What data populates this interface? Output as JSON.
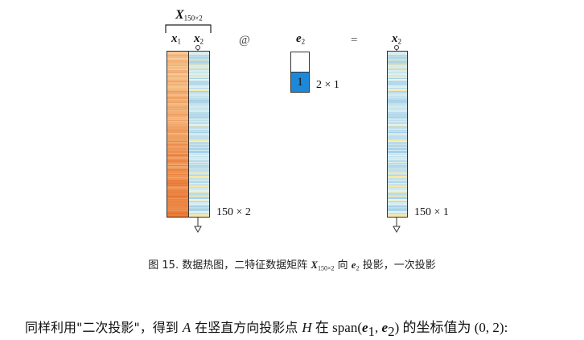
{
  "figure": {
    "matrix_label": "X",
    "matrix_label_sub": "150×2",
    "col1_label": "x",
    "col1_sub": "1",
    "col2_label": "x",
    "col2_sub": "2",
    "operator_at": "@",
    "vector_label": "e",
    "vector_sub": "2",
    "vector_values": [
      "",
      "1"
    ],
    "vector_dims": "2 × 1",
    "operator_eq": "=",
    "result_label": "x",
    "result_sub": "2",
    "matrix_dims": "150 × 2",
    "result_dims": "150 × 1",
    "colors": {
      "orange_col": "#f5a55a",
      "blue_col": "#cfe8f0",
      "vector_fill": "#1e88d8"
    }
  },
  "caption": {
    "prefix": "图 15. 数据热图，二特征数据矩阵 ",
    "matrix": "X",
    "matrix_sub": "150×2",
    "middle": " 向 ",
    "vec": "e",
    "vec_sub": "2",
    "suffix": " 投影，一次投影"
  },
  "paragraph": {
    "part1": "同样利用\"二次投影\"，得到 ",
    "A": "A",
    "part2": " 在竖直方向投影点 ",
    "H": "H",
    "part3": " 在 span(",
    "e1": "e",
    "e1_sub": "1",
    "comma": ", ",
    "e2": "e",
    "e2_sub": "2",
    "part4": ") 的坐标值为 (0, 2):"
  }
}
